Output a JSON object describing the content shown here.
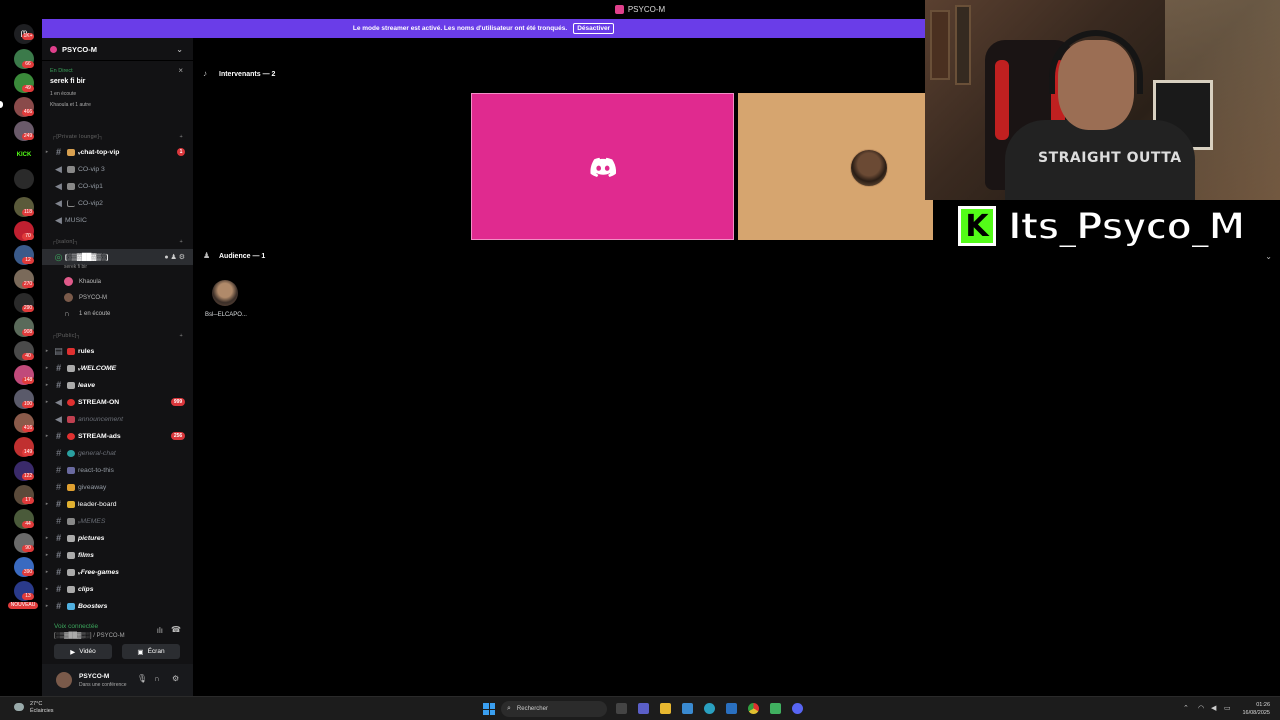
{
  "window": {
    "title": "PSYCO-M"
  },
  "banner": {
    "text": "Le mode streamer est activé. Les noms d'utilisateur ont été tronqués.",
    "button": "Désactiver"
  },
  "rail": {
    "badges": [
      "1K+",
      "66",
      "49",
      "466",
      "249",
      "118",
      "70",
      "12",
      "270",
      "290",
      "908",
      "40",
      "148",
      "100",
      "416",
      "149",
      "122",
      "17",
      "44",
      "90",
      "390",
      "13",
      "NOUVEAU"
    ]
  },
  "server": {
    "name": "PSYCO-M"
  },
  "live": {
    "status": "En Direct",
    "title": "serek fi bir",
    "listeners": "1 en écoute",
    "viewers": "Khaoula et 1 autre"
  },
  "categories": {
    "private": "┌[Private lounge]┐",
    "salon": "┌[salon]┐",
    "public": "┌[Public]┐"
  },
  "channels_private": [
    {
      "label": "ᵥchat-top-vip",
      "count": "1"
    },
    {
      "label": "CO-vip 3"
    },
    {
      "label": "CO-vip1"
    },
    {
      "label": "CO-vip2"
    },
    {
      "label": "MUSIC"
    }
  ],
  "salon": {
    "channel": "[░▒▓██▓▒░]",
    "sub": "serek fi bir",
    "members": [
      "Khaoula",
      "PSYCO-M"
    ],
    "listening": "1 en écoute"
  },
  "channels_public": [
    {
      "label": "rules"
    },
    {
      "label": "ᵥWELCOME"
    },
    {
      "label": "leave"
    },
    {
      "label": "STREAM-ON",
      "count": "999"
    },
    {
      "label": "announcement"
    },
    {
      "label": "STREAM-ads",
      "count": "256"
    },
    {
      "label": "general-chat"
    },
    {
      "label": "react-to-this"
    },
    {
      "label": "giveaway"
    },
    {
      "label": "leader-board"
    },
    {
      "label": "ᵥMEMES"
    },
    {
      "label": "pictures"
    },
    {
      "label": "films"
    },
    {
      "label": "ᵥFree-games"
    },
    {
      "label": "clips"
    },
    {
      "label": "Boosters"
    }
  ],
  "voice": {
    "status": "Voix connectée",
    "channel": "[░▒▓██▓▒░] / PSYCO-M",
    "video_label": "Vidéo",
    "screen_label": "Écran"
  },
  "user": {
    "name": "PSYCO-M",
    "status": "Dans une conférence"
  },
  "stage": {
    "speakers_header": "Intervenants — 2",
    "audience_header": "Audience — 1",
    "audience_member": "Bsl─ELCAPO..."
  },
  "overlay": {
    "kick_name": "Its_Psyco_M",
    "shirt_text": "STRAIGHT OUTTA"
  },
  "taskbar": {
    "temp": "27°C",
    "weather": "Éclaircies",
    "search": "Rechercher",
    "time": "01:26",
    "date": "16/08/2025"
  }
}
